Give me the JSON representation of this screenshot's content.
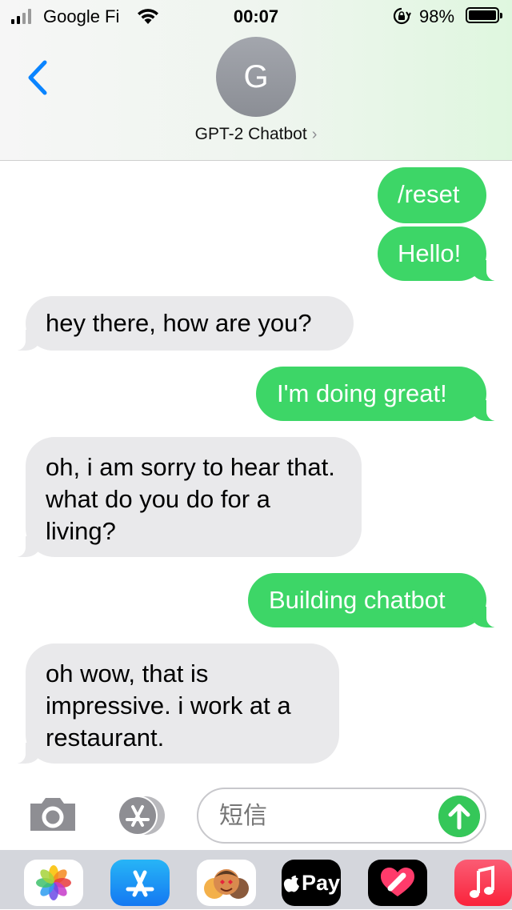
{
  "status_bar": {
    "carrier": "Google Fi",
    "time": "00:07",
    "battery": "98%"
  },
  "header": {
    "avatar_initial": "G",
    "contact_name": "GPT-2 Chatbot",
    "chevron": "›"
  },
  "messages": [
    {
      "from": "me",
      "text": "/reset"
    },
    {
      "from": "me",
      "text": "Hello!"
    },
    {
      "from": "bot",
      "text": "hey there, how are you?"
    },
    {
      "from": "me",
      "text": "I'm doing great!"
    },
    {
      "from": "bot",
      "text": "oh, i am sorry to hear that. what do you do for a living?"
    },
    {
      "from": "me",
      "text": "Building chatbot"
    },
    {
      "from": "bot",
      "text": "oh wow, that is impressive. i work at a restaurant."
    }
  ],
  "composer": {
    "placeholder": "短信"
  },
  "app_drawer": {
    "apps": [
      "photos-icon",
      "app-store-icon",
      "memoji-icon",
      "apple-pay-icon",
      "digital-touch-icon",
      "music-icon"
    ],
    "apple_pay_label": "Pay"
  },
  "colors": {
    "sent_bubble": "#3dd667",
    "received_bubble": "#e9e9eb",
    "ios_blue": "#0a84ff"
  }
}
